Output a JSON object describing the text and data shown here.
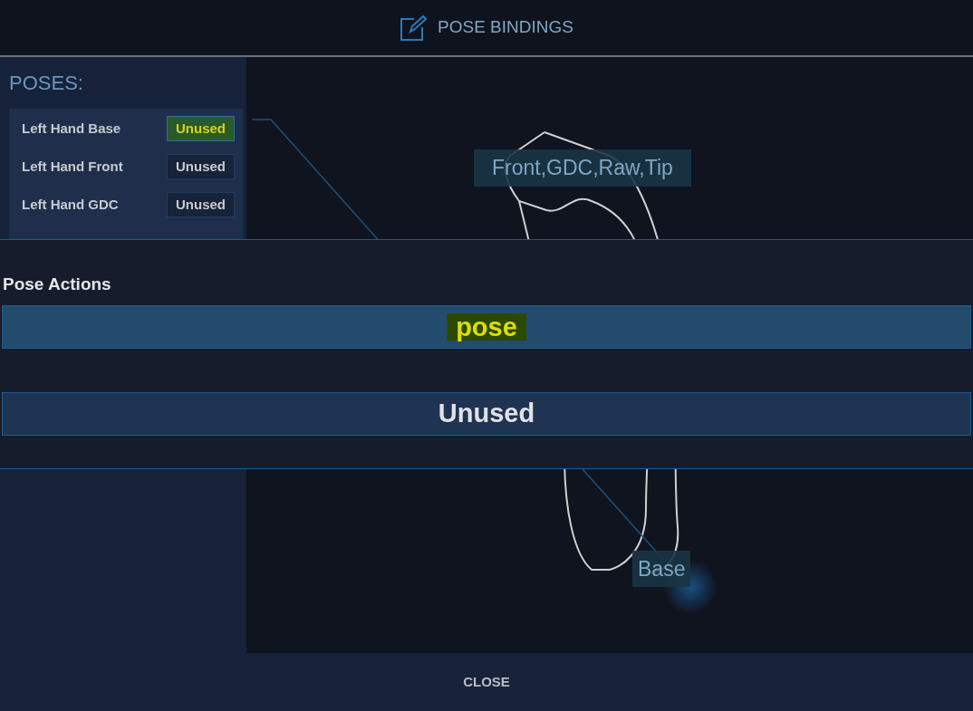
{
  "header": {
    "title": "POSE BINDINGS"
  },
  "poses": {
    "heading": "POSES:",
    "items": [
      {
        "label": "Left Hand Base",
        "binding": "Unused",
        "selected": true
      },
      {
        "label": "Left Hand Front",
        "binding": "Unused",
        "selected": false
      },
      {
        "label": "Left Hand GDC",
        "binding": "Unused",
        "selected": false
      }
    ]
  },
  "canvas": {
    "labels": [
      {
        "text": "Front,GDC,Raw,Tip",
        "kind": "top"
      },
      {
        "text": "Base",
        "kind": "base"
      }
    ]
  },
  "pose_actions": {
    "title": "Pose Actions",
    "options": [
      {
        "label": "pose",
        "selected": true
      },
      {
        "label": "Unused",
        "selected": false
      }
    ]
  },
  "footer": {
    "close": "CLOSE"
  }
}
